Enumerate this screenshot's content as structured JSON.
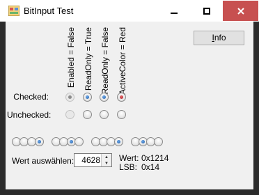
{
  "window": {
    "title": "BitInput Test",
    "close_color": "#c75050"
  },
  "columns": [
    "Enabled = False",
    "ReadOnly = True",
    "ReadOnly = False",
    "ActiveColor = Red"
  ],
  "rows": {
    "checked_label": "Checked:",
    "unchecked_label": "Unchecked:"
  },
  "checked_radios": [
    {
      "state": "checked",
      "dot_color": "gray",
      "enabled": false
    },
    {
      "state": "checked",
      "dot_color": "blue",
      "enabled": true
    },
    {
      "state": "checked",
      "dot_color": "blue",
      "enabled": true
    },
    {
      "state": "checked",
      "dot_color": "red",
      "enabled": true
    }
  ],
  "unchecked_radios": [
    {
      "state": "unchecked",
      "enabled": false
    },
    {
      "state": "unchecked",
      "enabled": true
    },
    {
      "state": "unchecked",
      "enabled": true
    },
    {
      "state": "unchecked",
      "enabled": true
    }
  ],
  "bits": [
    0,
    0,
    0,
    1,
    0,
    0,
    1,
    0,
    0,
    0,
    0,
    1,
    0,
    1,
    0,
    0
  ],
  "info_button": {
    "label_underlined": "I",
    "label_rest": "nfo"
  },
  "wert": {
    "label": "Wert auswählen:",
    "value": "4628",
    "wert_label": "Wert:",
    "wert_hex": "0x1214",
    "lsb_label": "LSB:",
    "lsb_hex": "0x14"
  },
  "icons": [
    "app-icon",
    "minimize-icon",
    "maximize-icon",
    "close-icon",
    "spin-up-icon",
    "spin-down-icon"
  ],
  "accent": {
    "blue": "#1f5da8",
    "red": "#b01f2a"
  }
}
